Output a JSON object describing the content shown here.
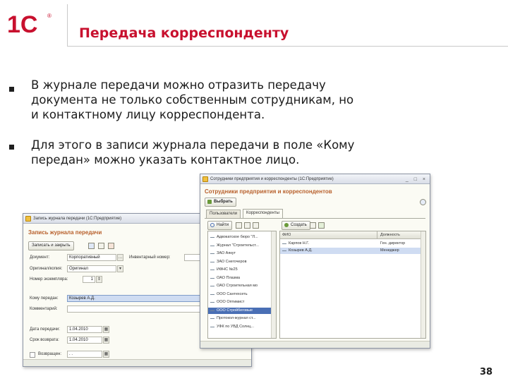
{
  "slide": {
    "title": "Передача корреспонденту",
    "bullets": [
      "В журнале передачи можно отразить передачу документа не только собственным сотрудникам, но и контактному лицу корреспондента.",
      "Для этого в записи журнала передачи в поле «Кому передан» можно указать контактное лицо."
    ],
    "page_number": "38"
  },
  "brand": {
    "accent": "#c8102e",
    "logo_text": "1С"
  },
  "journal_form": {
    "window_title": "Запись журнала передачи (1С:Предприятие)",
    "form_title": "Запись журнала передачи",
    "toolbar": {
      "save_close_label": "Записать и закрыть"
    },
    "fields": {
      "document_label": "Документ:",
      "document_value": "Корпоративный",
      "inventory_label": "Инвентарный номер:",
      "original_label": "Оригинал/копия:",
      "original_value": "Оригинал",
      "copy_no_label": "Номер экземпляра:",
      "copy_no_value": "1",
      "recipient_label": "Кому передан:",
      "recipient_value": "Козырев А.Д.",
      "comment_label": "Комментарий:",
      "transfer_date_label": "Дата передачи:",
      "transfer_date_value": "1.04.2010",
      "return_date_label": "Срок возврата:",
      "return_date_value": "1.04.2010",
      "returned_label": "Возвращен:",
      "returned_value": "  .  .  "
    }
  },
  "picker": {
    "window_title": "Сотрудники предприятия и корреспонденты (1С:Предприятие)",
    "form_title": "Сотрудники предприятия и корреспондентов",
    "select_button": "Выбрать",
    "tabs": [
      "Пользователи",
      "Корреспонденты"
    ],
    "left_toolbar": {
      "find_label": "Найти"
    },
    "right_toolbar": {
      "create_label": "Создать"
    },
    "correspondents": [
      "Адвокатское бюро \"Л...",
      "Журнал \"Строительст...",
      "ЗАО Аякут",
      "ЗАО Снегочеров",
      "ИФНС №25",
      "ОАО Плазма",
      "ОАО Строительная мо",
      "ООО Сантехсеть",
      "ООО Оптимист",
      "ООО Стройбеговые",
      "Протокол-журнал ст...",
      "УФК по УВД Солнц..."
    ],
    "selected_correspondent_index": 9,
    "contacts_columns": [
      "ФИО",
      "Должность"
    ],
    "contacts": [
      {
        "name": "Карпов Н.Г.",
        "position": "Ген. директор"
      },
      {
        "name": "Козырев А.Д.",
        "position": "Менеджер"
      }
    ],
    "selected_contact_index": 1
  }
}
